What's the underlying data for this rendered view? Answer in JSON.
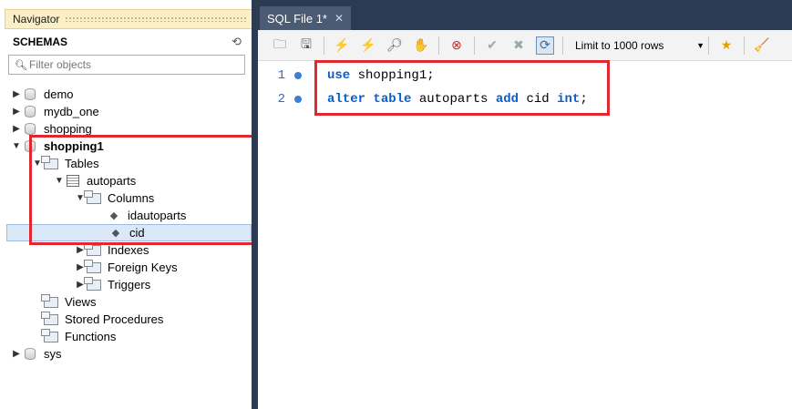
{
  "navigator": {
    "title": "Navigator",
    "schemas_label": "SCHEMAS",
    "filter_placeholder": "Filter objects",
    "tree": [
      {
        "label": "demo"
      },
      {
        "label": "mydb_one"
      },
      {
        "label": "shopping"
      },
      {
        "label": "shopping1"
      },
      {
        "label": "Tables"
      },
      {
        "label": "autoparts"
      },
      {
        "label": "Columns"
      },
      {
        "label": "idautoparts"
      },
      {
        "label": "cid"
      },
      {
        "label": "Indexes"
      },
      {
        "label": "Foreign Keys"
      },
      {
        "label": "Triggers"
      },
      {
        "label": "Views"
      },
      {
        "label": "Stored Procedures"
      },
      {
        "label": "Functions"
      },
      {
        "label": "sys"
      }
    ]
  },
  "editor": {
    "tab_label": "SQL File 1*",
    "limit_label": "Limit to 1000 rows",
    "lines": [
      {
        "num": "1",
        "parts": [
          {
            "kw": "use"
          },
          {
            "t": " shopping1;"
          }
        ]
      },
      {
        "num": "2",
        "parts": [
          {
            "kw": "alter"
          },
          {
            "t": " "
          },
          {
            "kw": "table"
          },
          {
            "t": " autoparts "
          },
          {
            "kw": "add"
          },
          {
            "t": " cid "
          },
          {
            "kw": "int"
          },
          {
            "t": ";"
          }
        ]
      }
    ]
  },
  "colors": {
    "highlight_box": "#e0282e",
    "keyword": "#0a5ec7",
    "tab_bar": "#2c3b52"
  }
}
